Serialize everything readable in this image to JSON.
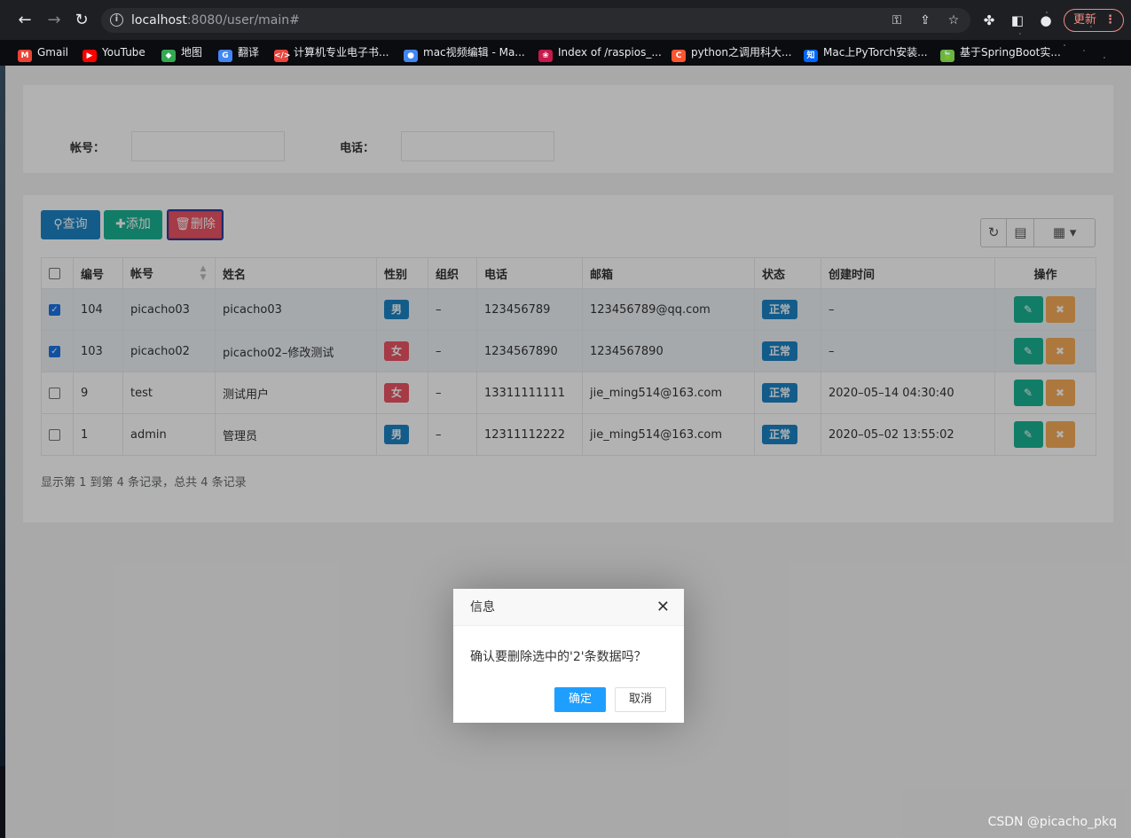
{
  "browser": {
    "url_host": "localhost",
    "url_rest": ":8080/user/main#",
    "update_label": "更新",
    "bookmarks": [
      {
        "label": "Gmail",
        "color": "#ea4335",
        "glyph": "M"
      },
      {
        "label": "YouTube",
        "color": "#ff0000",
        "glyph": "▶"
      },
      {
        "label": "地图",
        "color": "#34a853",
        "glyph": "◆"
      },
      {
        "label": "翻译",
        "color": "#4285f4",
        "glyph": "G"
      },
      {
        "label": "计算机专业电子书...",
        "color": "#e8453c",
        "glyph": "</>"
      },
      {
        "label": "mac视频编辑 - Ma...",
        "color": "#4285f4",
        "glyph": "●"
      },
      {
        "label": "Index of /raspios_...",
        "color": "#c51a4a",
        "glyph": "❀"
      },
      {
        "label": "python之调用科大...",
        "color": "#fc5531",
        "glyph": "C"
      },
      {
        "label": "Mac上PyTorch安装...",
        "color": "#0066ff",
        "glyph": "知"
      },
      {
        "label": "基于SpringBoot实...",
        "color": "#6db33f",
        "glyph": "🍃"
      }
    ]
  },
  "search": {
    "account_label": "帐号：",
    "account_value": "",
    "phone_label": "电话：",
    "phone_value": ""
  },
  "toolbar": {
    "query_label": "查询",
    "add_label": "添加",
    "delete_label": "删除"
  },
  "table": {
    "columns": [
      "",
      "编号",
      "帐号",
      "姓名",
      "性别",
      "组织",
      "电话",
      "邮箱",
      "状态",
      "创建时间",
      "操作"
    ],
    "rows": [
      {
        "checked": true,
        "id": "104",
        "account": "picacho03",
        "name": "picacho03",
        "gender": "男",
        "org": "–",
        "phone": "123456789",
        "email": "123456789@qq.com",
        "status": "正常",
        "created": "–"
      },
      {
        "checked": true,
        "id": "103",
        "account": "picacho02",
        "name": "picacho02–修改测试",
        "gender": "女",
        "org": "–",
        "phone": "1234567890",
        "email": "1234567890",
        "status": "正常",
        "created": "–"
      },
      {
        "checked": false,
        "id": "9",
        "account": "test",
        "name": "测试用户",
        "gender": "女",
        "org": "–",
        "phone": "13311111111",
        "email": "jie_ming514@163.com",
        "status": "正常",
        "created": "2020–05–14 04:30:40"
      },
      {
        "checked": false,
        "id": "1",
        "account": "admin",
        "name": "管理员",
        "gender": "男",
        "org": "–",
        "phone": "12311112222",
        "email": "jie_ming514@163.com",
        "status": "正常",
        "created": "2020–05–02 13:55:02"
      }
    ],
    "footer": "显示第 1 到第 4 条记录，总共 4 条记录"
  },
  "dialog": {
    "title": "信息",
    "message": "确认要删除选中的'2'条数据吗？",
    "confirm_label": "确定",
    "cancel_label": "取消"
  },
  "watermark": "CSDN @picacho_pkq",
  "colors": {
    "primary": "#1c84c6",
    "success": "#1ab394",
    "danger": "#ed5565",
    "warning": "#f8ac59",
    "dialog_confirm": "#1e9fff"
  }
}
